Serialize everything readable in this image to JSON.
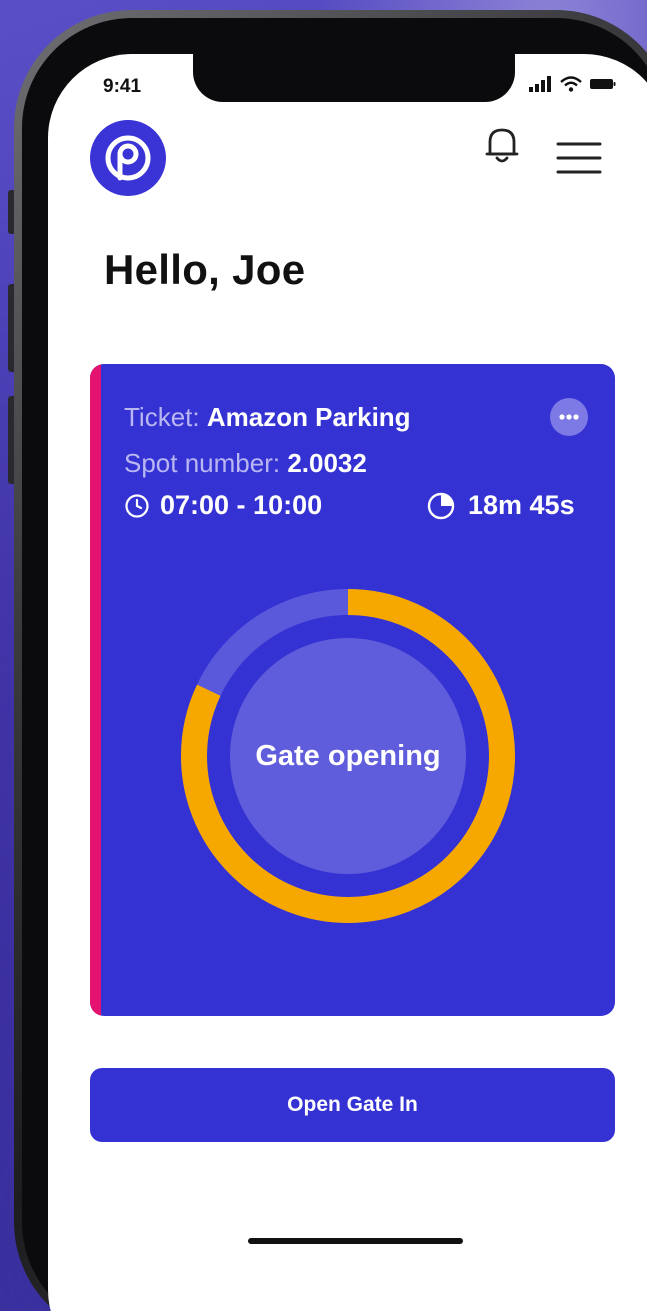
{
  "status_bar": {
    "time": "9:41",
    "icons": [
      "signal-icon",
      "wifi-icon",
      "battery-icon"
    ]
  },
  "header": {
    "logo_icon": "parking-logo-icon",
    "logo_letter": "P",
    "notification_icon": "bell-icon",
    "menu_icon": "hamburger-menu-icon"
  },
  "greeting": "Hello, Joe",
  "ticket": {
    "ticket_label": "Ticket:",
    "ticket_name": "Amazon Parking",
    "spot_label": "Spot number:",
    "spot_number": "2.0032",
    "time_range": "07:00 - 10:00",
    "time_remaining": "18m 45s",
    "more_icon": "more-dots-icon",
    "clock_icon": "clock-icon",
    "timer_icon": "pie-timer-icon"
  },
  "gate": {
    "status_label": "Gate opening",
    "progress_fraction": 0.82
  },
  "actions": {
    "open_gate_label": "Open Gate In"
  },
  "colors": {
    "primary": "#3532d3",
    "accent_stripe": "#e3136f",
    "progress": "#f6a800",
    "track": "#5a58db",
    "inner_circle": "#5f5ddc",
    "background": "#4a3fb3"
  }
}
